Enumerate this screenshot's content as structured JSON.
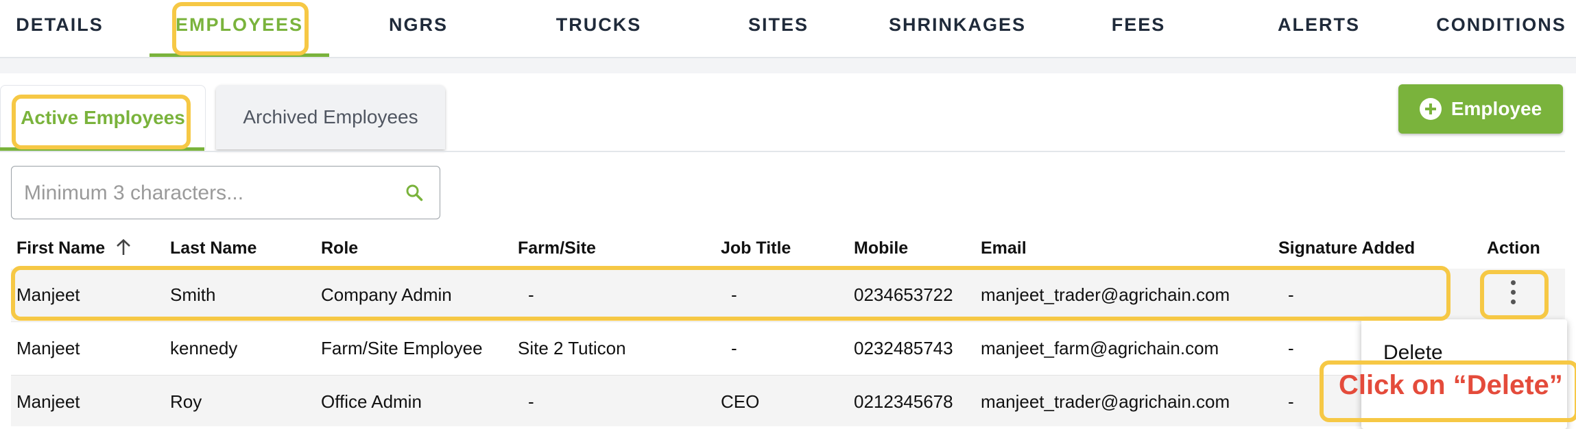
{
  "nav": {
    "tabs": [
      "DETAILS",
      "EMPLOYEES",
      "NGRS",
      "TRUCKS",
      "SITES",
      "SHRINKAGES",
      "FEES",
      "ALERTS",
      "CONDITIONS"
    ],
    "active_tab": "EMPLOYEES"
  },
  "subtabs": {
    "active": "Active Employees",
    "archived": "Archived Employees"
  },
  "add_button": {
    "label": "Employee",
    "icon": "plus-circle-icon"
  },
  "search": {
    "placeholder": "Minimum 3 characters...",
    "value": "",
    "icon": "search-icon"
  },
  "table": {
    "columns": [
      "First Name",
      "Last Name",
      "Role",
      "Farm/Site",
      "Job Title",
      "Mobile",
      "Email",
      "Signature Added",
      "Action"
    ],
    "sort": {
      "column": "First Name",
      "direction": "ascending",
      "icon": "arrow-up-icon"
    },
    "rows": [
      [
        "Manjeet",
        "Smith",
        "Company Admin",
        "-",
        "-",
        "0234653722",
        "manjeet_trader@agrichain.com",
        "-"
      ],
      [
        "Manjeet",
        "kennedy",
        "Farm/Site Employee",
        "Site 2 Tuticon",
        "-",
        "0232485743",
        "manjeet_farm@agrichain.com",
        "-"
      ],
      [
        "Manjeet",
        "Roy",
        "Office Admin",
        "-",
        "CEO",
        "0212345678",
        "manjeet_trader@agrichain.com",
        "-"
      ]
    ]
  },
  "action_menu": {
    "items": [
      "Delete"
    ]
  },
  "annotation": {
    "text": "Click on “Delete”"
  },
  "colors": {
    "accent": "#7ab33c",
    "highlight": "#f6c845",
    "callout": "#e44b3b"
  }
}
